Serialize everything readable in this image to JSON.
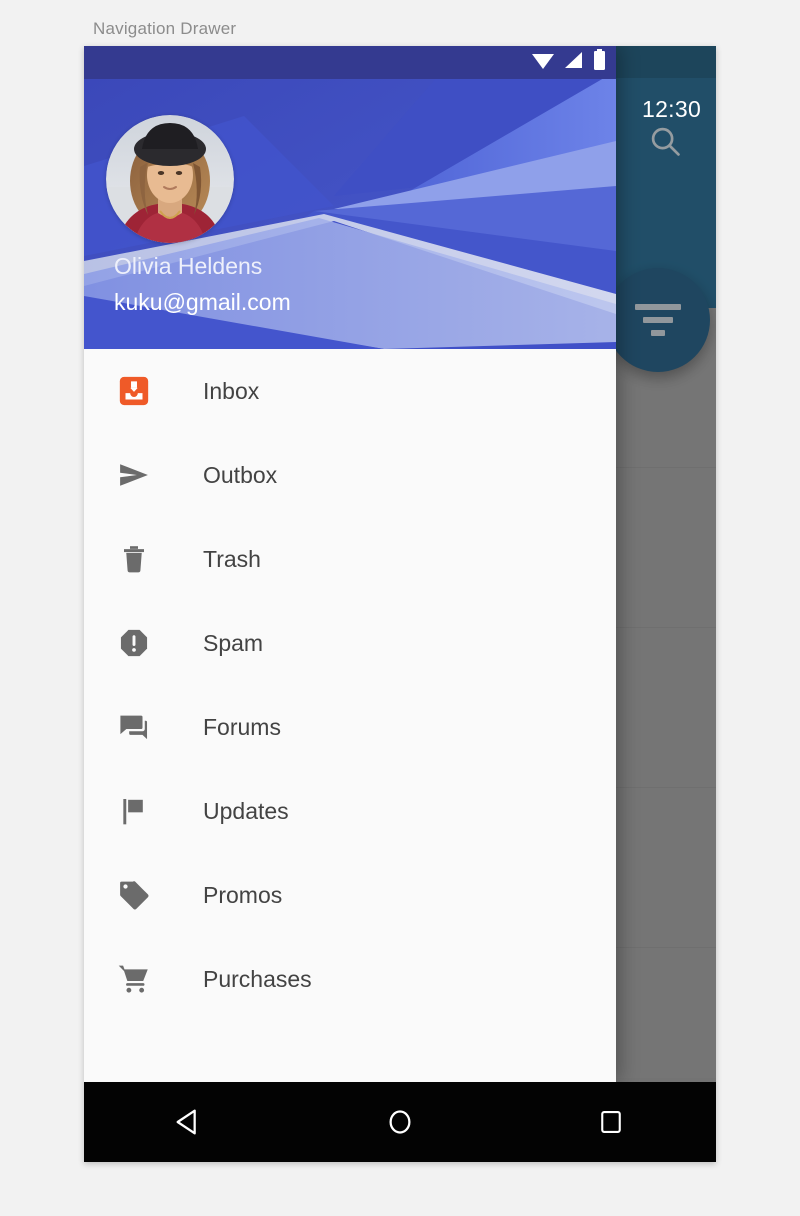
{
  "caption": "Navigation Drawer",
  "status_bar": {
    "time": "12:30",
    "icons": [
      "wifi-icon",
      "cell-signal-icon",
      "battery-icon"
    ]
  },
  "drawer": {
    "profile": {
      "name": "Olivia Heldens",
      "email": "kuku@gmail.com",
      "avatar_alt": "user-avatar"
    },
    "items": [
      {
        "label": "Inbox",
        "icon": "inbox-icon"
      },
      {
        "label": "Outbox",
        "icon": "send-icon"
      },
      {
        "label": "Trash",
        "icon": "trash-icon"
      },
      {
        "label": "Spam",
        "icon": "report-icon"
      },
      {
        "label": "Forums",
        "icon": "forum-icon"
      },
      {
        "label": "Updates",
        "icon": "flag-icon"
      },
      {
        "label": "Promos",
        "icon": "tag-icon"
      },
      {
        "label": "Purchases",
        "icon": "shopping-cart-icon"
      }
    ]
  },
  "background_app": {
    "search_icon": "search-icon",
    "fab_icon": "filter-list-icon"
  },
  "system_nav": {
    "back": "back-icon",
    "home": "home-icon",
    "recents": "recents-icon"
  },
  "colors": {
    "canvas": "#f2f2f2",
    "caption_text": "#8c8c8c",
    "status_bar": "#343a90",
    "drawer_header_blue": "#4254c5",
    "drawer_surface": "#fafafa",
    "accent_orange": "#ef5a28",
    "icon_gray": "#6b6b6b",
    "label_text": "#434343",
    "app_bar_teal": "#2e6d91",
    "fab_blue": "#2b6285",
    "nav_bar": "#030303"
  }
}
